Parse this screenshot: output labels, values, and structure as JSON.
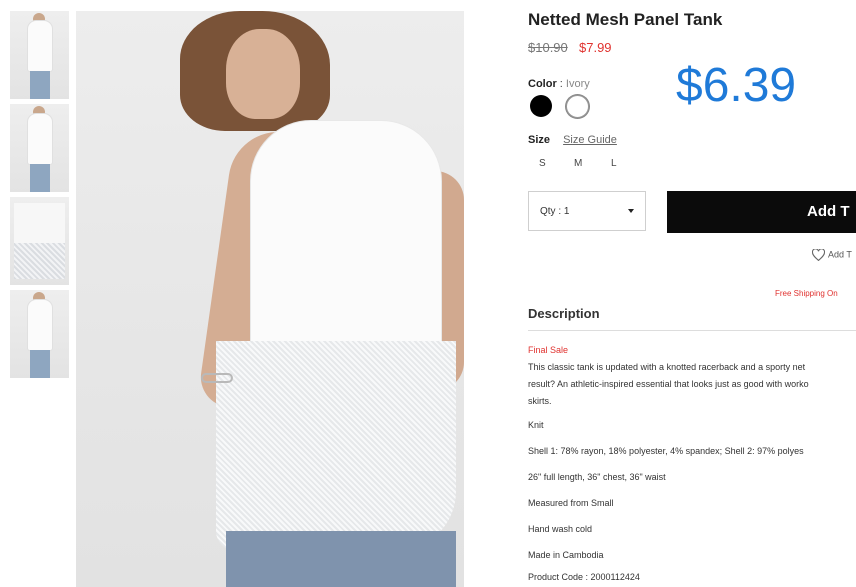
{
  "product": {
    "title": "Netted Mesh Panel Tank",
    "old_price": "$10.90",
    "new_price": "$7.99",
    "highlight_price": "$6.39"
  },
  "color": {
    "label": "Color",
    "separator": ":",
    "value": "Ivory"
  },
  "size": {
    "label": "Size",
    "guide": "Size Guide",
    "options": [
      "S",
      "M",
      "L"
    ]
  },
  "qty": {
    "label": "Qty : 1"
  },
  "add_button": "Add T",
  "wishlist": "Add T",
  "shipping": "Free Shipping On",
  "description": {
    "heading": "Description",
    "final_sale": "Final Sale",
    "lines": [
      "This classic tank is updated with a knotted racerback and a sporty net",
      "result? An athletic-inspired essential that looks just as good with worko",
      "skirts."
    ],
    "details": [
      "Knit",
      "Shell 1: 78% rayon, 18% polyester, 4% spandex; Shell 2: 97% polyes",
      "26\" full length, 36\" chest, 36\" waist",
      "Measured from Small",
      "Hand wash cold",
      "Made in Cambodia",
      "Product Code : 2000112424"
    ]
  },
  "colors": {
    "accent_price": "#1f7ad8",
    "sale_red": "#e0322f",
    "button_bg": "#0b0b0b"
  }
}
